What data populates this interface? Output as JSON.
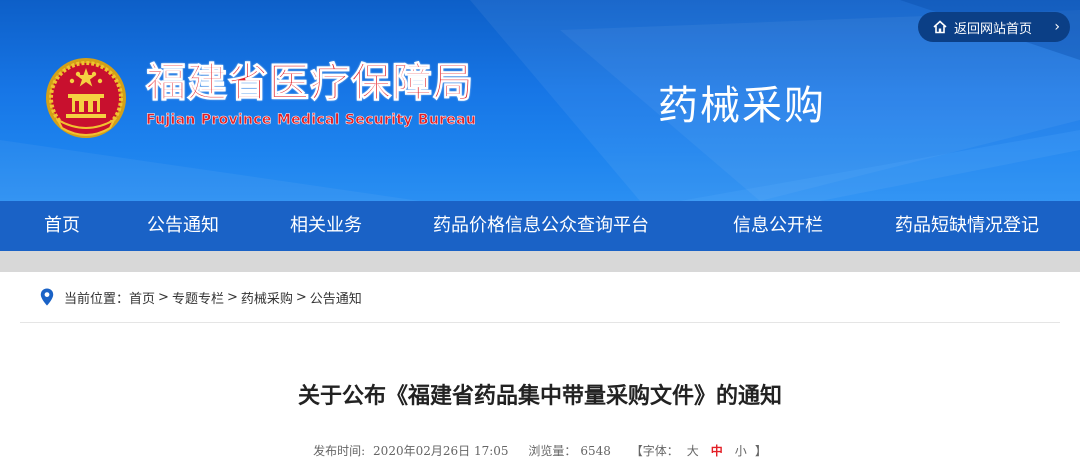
{
  "header": {
    "home_button_label": "返回网站首页",
    "home_chevron": "›",
    "org_name_cn": "福建省医疗保障局",
    "org_name_en": "Fujian Province Medical Security Bureau",
    "section_title": "药械采购",
    "colors": {
      "brand_red": "#e31f26",
      "banner_blue": "#1776e6",
      "nav_blue": "#1a62c6"
    }
  },
  "nav": {
    "items": [
      {
        "label": "首页"
      },
      {
        "label": "公告通知"
      },
      {
        "label": "相关业务"
      },
      {
        "label": "药品价格信息公众查询平台"
      },
      {
        "label": "信息公开栏"
      },
      {
        "label": "药品短缺情况登记"
      }
    ]
  },
  "breadcrumb": {
    "prefix": "当前位置：",
    "items": [
      "首页",
      "专题专栏",
      "药械采购",
      "公告通知"
    ],
    "separator": ">"
  },
  "article": {
    "title": "关于公布《福建省药品集中带量采购文件》的通知",
    "publish_label": "发布时间:",
    "publish_time": "2020年02月26日 17:05",
    "views_label": "浏览量：",
    "views": "6548",
    "font_open": "【字体：",
    "font_large": "大",
    "font_medium": "中",
    "font_small": "小",
    "font_close": "】"
  }
}
